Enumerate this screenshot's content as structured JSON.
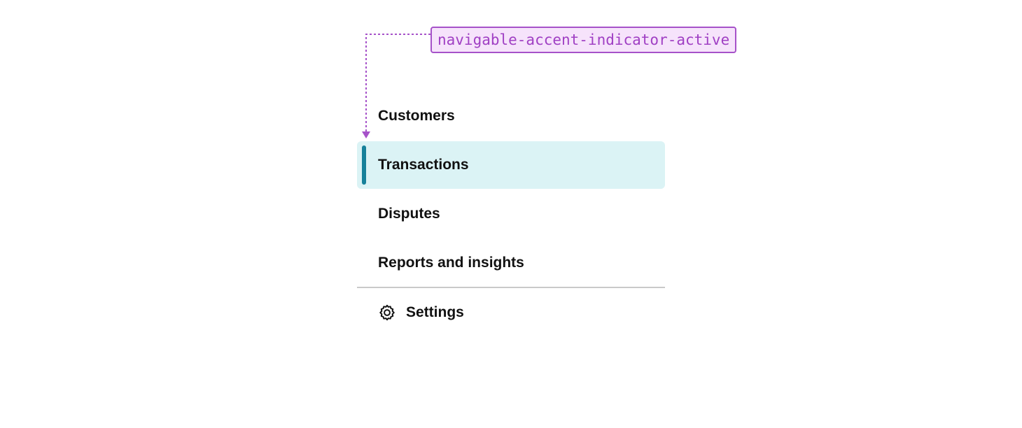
{
  "annotation": {
    "label": "navigable-accent-indicator-active",
    "color": "#a652c9"
  },
  "nav": {
    "items": [
      {
        "label": "Customers",
        "active": false
      },
      {
        "label": "Transactions",
        "active": true
      },
      {
        "label": "Disputes",
        "active": false
      },
      {
        "label": "Reports and insights",
        "active": false
      }
    ],
    "settings": {
      "label": "Settings",
      "icon": "gear-icon"
    }
  },
  "colors": {
    "active_background": "#dbf3f5",
    "accent_indicator": "#16819a",
    "divider": "#c9c9c9"
  }
}
